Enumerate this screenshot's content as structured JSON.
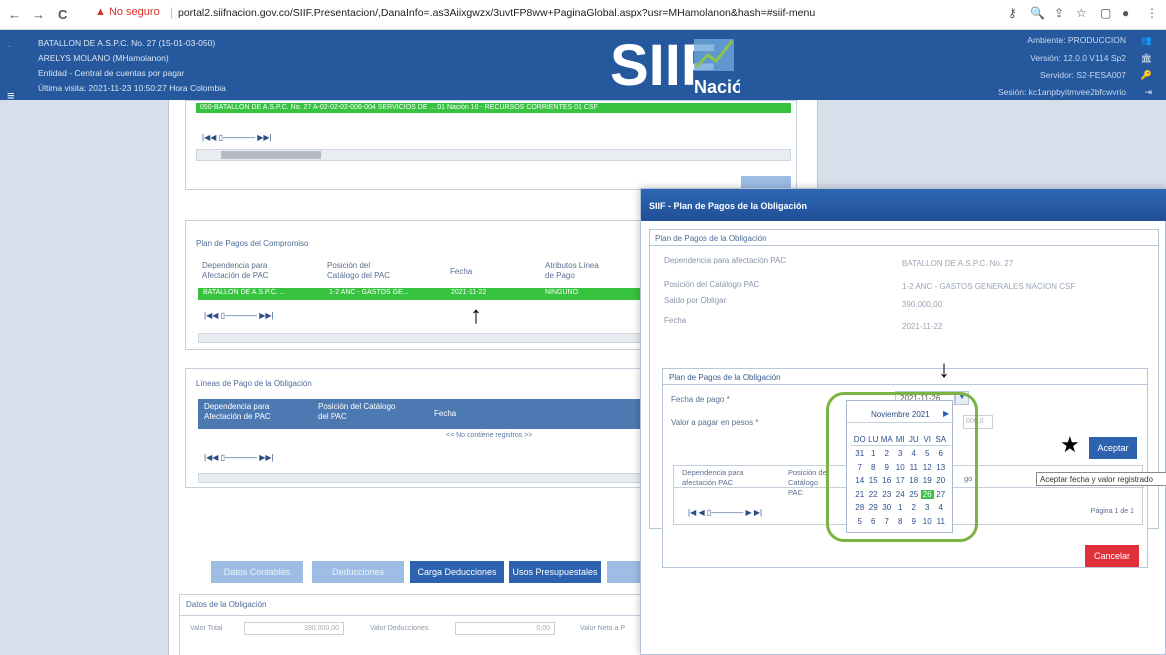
{
  "browser": {
    "back": "←",
    "forward": "→",
    "reload": "C",
    "warning": "▲ No seguro",
    "url": "portal2.siifnacion.gov.co/SIIF.Presentacion/,DanaInfo=.as3Aiixgwzx/3uvtFP8ww+PaginaGlobal.aspx?usr=MHamolanon&hash=#siif-menu"
  },
  "header": {
    "entity_line1": "BATALLON DE A.S.P.C. No. 27 (15-01-03-050)",
    "user": "ARELYS MOLANO (MHamolanon)",
    "entidad": "Entidad - Central de cuentas por pagar",
    "last_visit": "Última visita: 2021-11-23 10:50:27 Hora Colombia",
    "ambiente": "Ambiente: PRODUCCION",
    "version": "Versión: 12.0.0 V114 Sp2",
    "servidor": "Servidor: S2-FESA007",
    "sesion": "Sesión: kc1anpbyitmvee2bfcwvrio",
    "logo_text": "SIIF",
    "logo_sub": "Nación"
  },
  "top_panel": {
    "green_row": "050-BATALLON DE A.S.P.C. No. 27     A-02-02-02-006-004 SERVICIOS DE ...  01 Nación        10 - RECURSOS CORRIENTES        01 CSF",
    "pager": "|◀◀ ▯———— ▶▶|"
  },
  "plan_compromiso": {
    "title": "Plan de Pagos del Compromiso",
    "headers": [
      "Dependencia para Afectación de PAC",
      "Posición del Catálogo del PAC",
      "Fecha",
      "Atributos Línea de Pago"
    ],
    "row": [
      "BATALLON DE A.S.P.C. ...",
      "1-2 ANC - GASTOS GE...",
      "2021-11-22",
      "NINGUNO"
    ],
    "pager": "|◀◀ ▯———— ▶▶|"
  },
  "lineas_pago": {
    "title": "Líneas de Pago de la Obligación",
    "headers": [
      "Dependencia para Afectación de PAC",
      "Posición del Catálogo del PAC",
      "Fecha"
    ],
    "empty": "<< No contiene registros >>",
    "pager": "|◀◀ ▯———— ▶▶|"
  },
  "bottom_buttons": [
    "Datos Contables",
    "Deducciones",
    "Carga Deducciones",
    "Usos Presupuestales"
  ],
  "datos_obligacion": {
    "title": "Datos de la Obligación",
    "valor_total_label": "Valor Total",
    "valor_total": "390.000,00",
    "deducciones_label": "Valor Deducciones",
    "deducciones": "0,00",
    "neto_label": "Valor Neto a P"
  },
  "modal": {
    "title": "SIIF - Plan de Pagos de la Obligación",
    "panel_title": "Plan de Pagos de la Obligación",
    "fields": [
      {
        "label": "Dependencia para afectación PAC",
        "value": "BATALLON DE A.S.P.C. No. 27"
      },
      {
        "label": "Posición del Catálogo PAC",
        "value": "1-2 ANC - GASTOS GENERALES NACION CSF"
      },
      {
        "label": "Saldo por Obligar",
        "value": "390.000,00"
      },
      {
        "label": "Fecha",
        "value": "2021-11-22"
      }
    ],
    "sub_title": "Plan de Pagos de la Obligación",
    "fecha_pago_label": "Fecha de pago *",
    "fecha_pago_value": "2021-11-26",
    "valor_label": "Valor a pagar en pesos *",
    "valor_value": "000,0",
    "aceptar": "Aceptar",
    "tooltip": "Aceptar fecha y valor registrado",
    "grid_headers": [
      "Dependencia para afectación PAC",
      "Posición del Catálogo PAC",
      "go"
    ],
    "pager": "|◀ ◀ ▯———— ▶ ▶|",
    "page": "Página 1 de 1",
    "cancelar": "Cancelar"
  },
  "calendar": {
    "month": "Noviembre 2021",
    "days": [
      "DO",
      "LU",
      "MA",
      "MI",
      "JU",
      "VI",
      "SA"
    ],
    "weeks": [
      [
        "31",
        "1",
        "2",
        "3",
        "4",
        "5",
        "6"
      ],
      [
        "7",
        "8",
        "9",
        "10",
        "11",
        "12",
        "13"
      ],
      [
        "14",
        "15",
        "16",
        "17",
        "18",
        "19",
        "20"
      ],
      [
        "21",
        "22",
        "23",
        "24",
        "25",
        "26",
        "27"
      ],
      [
        "28",
        "29",
        "30",
        "1",
        "2",
        "3",
        "4"
      ],
      [
        "5",
        "6",
        "7",
        "8",
        "9",
        "10",
        "11"
      ]
    ],
    "selected": "26"
  },
  "annotations": {
    "star": "★",
    "arrow": "↑",
    "arrow_down": "↓"
  },
  "colors": {
    "header": "#25589d",
    "green": "#37c23f",
    "accent_box": "#7cb342",
    "cancel": "#e0313a"
  }
}
